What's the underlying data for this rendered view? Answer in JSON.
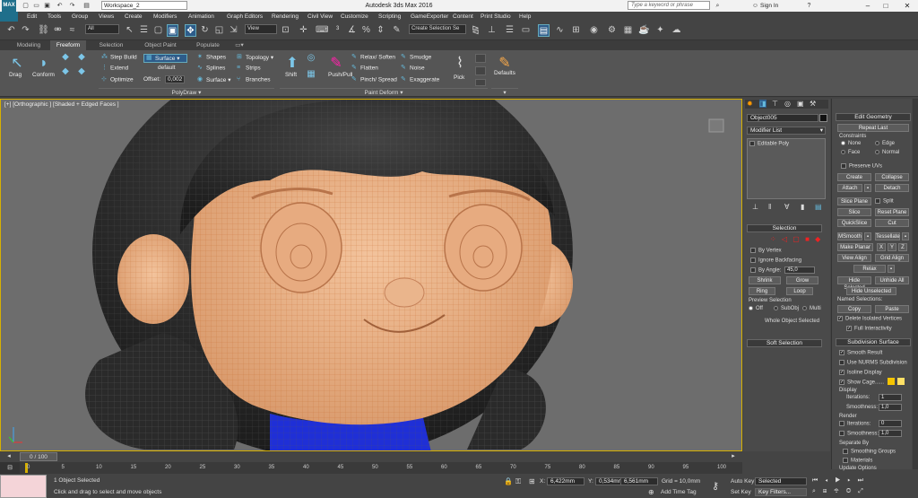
{
  "titlebar": {
    "logo": "MAX",
    "workspace": "Workspace_2",
    "title": "Autodesk 3ds Max 2016",
    "search_placeholder": "Type a keyword or phrase",
    "sign_in": "Sign In",
    "minimize": "–",
    "maximize": "□",
    "close": "✕"
  },
  "menu": [
    "Edit",
    "Tools",
    "Group",
    "Views",
    "Create",
    "Modifiers",
    "Animation",
    "Graph Editors",
    "Rendering",
    "Civil View",
    "Customize",
    "Scripting",
    "GameExporter",
    "Content",
    "Print Studio",
    "Help"
  ],
  "toolbar": {
    "selection_filter": "All",
    "ref_coord": "View",
    "named_selection": "Create Selection Se"
  },
  "ribbon_tabs": [
    "Modeling",
    "Freeform",
    "Selection",
    "Object Paint",
    "Populate"
  ],
  "active_tab": "Freeform",
  "ribbon": {
    "drag": "Drag",
    "conform": "Conform",
    "step_build": "Step Build",
    "extend": "Extend",
    "optimize": "Optimize",
    "surface_btn": "Surface",
    "default": "default",
    "offset_label": "Offset:",
    "offset_value": "0,002",
    "shapes": "Shapes",
    "splines": "Splines",
    "surface": "Surface",
    "topology": "Topology",
    "strips": "Strips",
    "branches": "Branches",
    "shift": "Shift",
    "push_pull": "Push/Pull",
    "relax_soften": "Relax/ Soften",
    "flatten": "Flatten",
    "pinch_spread": "Pinch/ Spread",
    "smudge": "Smudge",
    "noise": "Noise",
    "exaggerate": "Exaggerate",
    "pick": "Pick",
    "defaults": "Defaults",
    "group_polydraw": "PolyDraw",
    "group_paintdeform": "Paint Deform"
  },
  "viewport": {
    "label": "[+] [Orthographic ] [Shaded + Edged Faces ]"
  },
  "command_panel": {
    "object_name": "Object005",
    "modifier_list": "Modifier List",
    "stack_item": "Editable Poly",
    "selection_title": "Selection",
    "by_vertex": "By Vertex",
    "ignore_backfacing": "Ignore Backfacing",
    "by_angle": "By Angle:",
    "by_angle_value": "45,0",
    "shrink": "Shrink",
    "grow": "Grow",
    "ring": "Ring",
    "loop": "Loop",
    "preview_selection": "Preview Selection",
    "off": "Off",
    "subobj": "SubObj",
    "multi": "Multi",
    "whole_object": "Whole Object Selected",
    "soft_selection": "Soft Selection"
  },
  "rollout": {
    "edit_geometry": "Edit Geometry",
    "repeat_last": "Repeat Last",
    "constraints": "Constraints",
    "none": "None",
    "edge": "Edge",
    "face": "Face",
    "normal": "Normal",
    "preserve_uvs": "Preserve UVs",
    "create": "Create",
    "collapse": "Collapse",
    "attach": "Attach",
    "detach": "Detach",
    "slice_plane": "Slice Plane",
    "split": "Split",
    "slice": "Slice",
    "reset_plane": "Reset Plane",
    "quickslice": "QuickSlice",
    "cut": "Cut",
    "msmooth": "MSmooth",
    "tessellate": "Tessellate",
    "make_planar": "Make Planar",
    "x": "X",
    "y": "Y",
    "z": "Z",
    "view_align": "View Align",
    "grid_align": "Grid Align",
    "relax": "Relax",
    "hide_selected": "Hide Selected",
    "unhide_all": "Unhide All",
    "hide_unselected": "Hide Unselected",
    "named_selections": "Named Selections:",
    "copy": "Copy",
    "paste": "Paste",
    "delete_isolated": "Delete Isolated Vertices",
    "full_interactivity": "Full Interactivity",
    "subdivision_surface": "Subdivision Surface",
    "smooth_result": "Smooth Result",
    "use_nurms": "Use NURMS Subdivision",
    "isoline_display": "Isoline Display",
    "show_cage": "Show Cage......",
    "display": "Display",
    "iterations": "Iterations:",
    "iterations_value": "1",
    "smoothness": "Smoothness:",
    "smoothness_value": "1,0",
    "render": "Render",
    "r_iterations_value": "0",
    "r_smoothness_value": "1,0",
    "separate_by": "Separate By",
    "smoothing_groups": "Smoothing Groups",
    "materials": "Materials",
    "update_options": "Update Options"
  },
  "timeline": {
    "frame": "0 / 100",
    "ticks": [
      "0",
      "5",
      "10",
      "15",
      "20",
      "25",
      "30",
      "35",
      "40",
      "45",
      "50",
      "55",
      "60",
      "65",
      "70",
      "75",
      "80",
      "85",
      "90",
      "95",
      "100"
    ]
  },
  "status": {
    "selected": "1 Object Selected",
    "prompt": "Click and drag to select and move objects",
    "x_label": "X:",
    "x_value": "6,422mm",
    "y_label": "Y:",
    "y_value": "0,534mm",
    "z_label": "Z:",
    "z_value": "6,561mm",
    "grid": "Grid = 10,0mm",
    "auto_key": "Auto Key",
    "set_key": "Set Key",
    "key_mode": "Selected",
    "key_filters": "Key Filters...",
    "add_time_tag": "Add Time Tag"
  },
  "colors": {
    "skin": "#e9b48a",
    "wire": "#f2a26a",
    "hair": "#3a3a3a",
    "sweater": "#1f2fd6",
    "viewport_border": "#d6b000"
  }
}
